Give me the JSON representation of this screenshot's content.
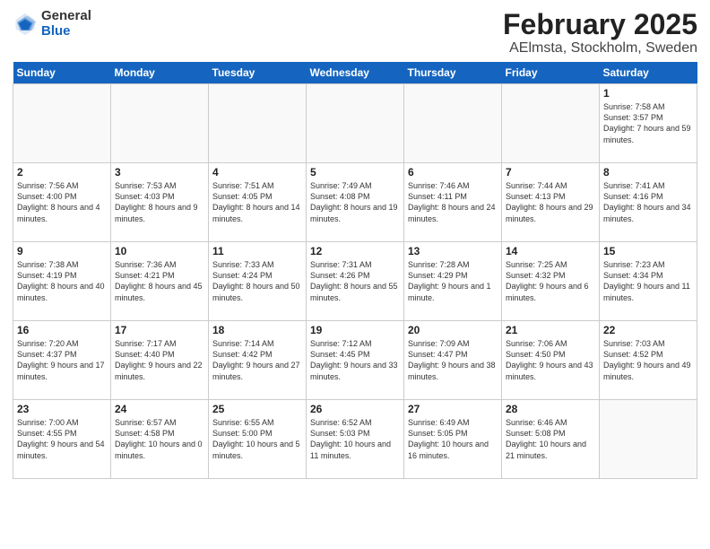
{
  "header": {
    "logo_line1": "General",
    "logo_line2": "Blue",
    "month": "February 2025",
    "location": "AElmsta, Stockholm, Sweden"
  },
  "weekdays": [
    "Sunday",
    "Monday",
    "Tuesday",
    "Wednesday",
    "Thursday",
    "Friday",
    "Saturday"
  ],
  "weeks": [
    [
      {
        "day": "",
        "info": ""
      },
      {
        "day": "",
        "info": ""
      },
      {
        "day": "",
        "info": ""
      },
      {
        "day": "",
        "info": ""
      },
      {
        "day": "",
        "info": ""
      },
      {
        "day": "",
        "info": ""
      },
      {
        "day": "1",
        "info": "Sunrise: 7:58 AM\nSunset: 3:57 PM\nDaylight: 7 hours and 59 minutes."
      }
    ],
    [
      {
        "day": "2",
        "info": "Sunrise: 7:56 AM\nSunset: 4:00 PM\nDaylight: 8 hours and 4 minutes."
      },
      {
        "day": "3",
        "info": "Sunrise: 7:53 AM\nSunset: 4:03 PM\nDaylight: 8 hours and 9 minutes."
      },
      {
        "day": "4",
        "info": "Sunrise: 7:51 AM\nSunset: 4:05 PM\nDaylight: 8 hours and 14 minutes."
      },
      {
        "day": "5",
        "info": "Sunrise: 7:49 AM\nSunset: 4:08 PM\nDaylight: 8 hours and 19 minutes."
      },
      {
        "day": "6",
        "info": "Sunrise: 7:46 AM\nSunset: 4:11 PM\nDaylight: 8 hours and 24 minutes."
      },
      {
        "day": "7",
        "info": "Sunrise: 7:44 AM\nSunset: 4:13 PM\nDaylight: 8 hours and 29 minutes."
      },
      {
        "day": "8",
        "info": "Sunrise: 7:41 AM\nSunset: 4:16 PM\nDaylight: 8 hours and 34 minutes."
      }
    ],
    [
      {
        "day": "9",
        "info": "Sunrise: 7:38 AM\nSunset: 4:19 PM\nDaylight: 8 hours and 40 minutes."
      },
      {
        "day": "10",
        "info": "Sunrise: 7:36 AM\nSunset: 4:21 PM\nDaylight: 8 hours and 45 minutes."
      },
      {
        "day": "11",
        "info": "Sunrise: 7:33 AM\nSunset: 4:24 PM\nDaylight: 8 hours and 50 minutes."
      },
      {
        "day": "12",
        "info": "Sunrise: 7:31 AM\nSunset: 4:26 PM\nDaylight: 8 hours and 55 minutes."
      },
      {
        "day": "13",
        "info": "Sunrise: 7:28 AM\nSunset: 4:29 PM\nDaylight: 9 hours and 1 minute."
      },
      {
        "day": "14",
        "info": "Sunrise: 7:25 AM\nSunset: 4:32 PM\nDaylight: 9 hours and 6 minutes."
      },
      {
        "day": "15",
        "info": "Sunrise: 7:23 AM\nSunset: 4:34 PM\nDaylight: 9 hours and 11 minutes."
      }
    ],
    [
      {
        "day": "16",
        "info": "Sunrise: 7:20 AM\nSunset: 4:37 PM\nDaylight: 9 hours and 17 minutes."
      },
      {
        "day": "17",
        "info": "Sunrise: 7:17 AM\nSunset: 4:40 PM\nDaylight: 9 hours and 22 minutes."
      },
      {
        "day": "18",
        "info": "Sunrise: 7:14 AM\nSunset: 4:42 PM\nDaylight: 9 hours and 27 minutes."
      },
      {
        "day": "19",
        "info": "Sunrise: 7:12 AM\nSunset: 4:45 PM\nDaylight: 9 hours and 33 minutes."
      },
      {
        "day": "20",
        "info": "Sunrise: 7:09 AM\nSunset: 4:47 PM\nDaylight: 9 hours and 38 minutes."
      },
      {
        "day": "21",
        "info": "Sunrise: 7:06 AM\nSunset: 4:50 PM\nDaylight: 9 hours and 43 minutes."
      },
      {
        "day": "22",
        "info": "Sunrise: 7:03 AM\nSunset: 4:52 PM\nDaylight: 9 hours and 49 minutes."
      }
    ],
    [
      {
        "day": "23",
        "info": "Sunrise: 7:00 AM\nSunset: 4:55 PM\nDaylight: 9 hours and 54 minutes."
      },
      {
        "day": "24",
        "info": "Sunrise: 6:57 AM\nSunset: 4:58 PM\nDaylight: 10 hours and 0 minutes."
      },
      {
        "day": "25",
        "info": "Sunrise: 6:55 AM\nSunset: 5:00 PM\nDaylight: 10 hours and 5 minutes."
      },
      {
        "day": "26",
        "info": "Sunrise: 6:52 AM\nSunset: 5:03 PM\nDaylight: 10 hours and 11 minutes."
      },
      {
        "day": "27",
        "info": "Sunrise: 6:49 AM\nSunset: 5:05 PM\nDaylight: 10 hours and 16 minutes."
      },
      {
        "day": "28",
        "info": "Sunrise: 6:46 AM\nSunset: 5:08 PM\nDaylight: 10 hours and 21 minutes."
      },
      {
        "day": "",
        "info": ""
      }
    ]
  ]
}
